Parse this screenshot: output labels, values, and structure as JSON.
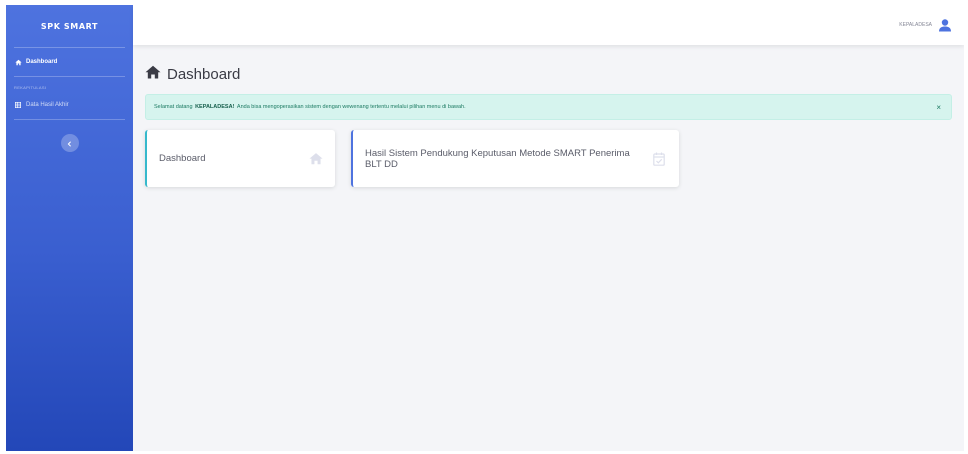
{
  "brand": "SPK SMART",
  "sidebar": {
    "items": [
      {
        "label": "Dashboard",
        "icon": "home-icon"
      }
    ],
    "heading": "Rekapitulasi",
    "sub_items": [
      {
        "label": "Data Hasil Akhir",
        "icon": "table-icon"
      }
    ],
    "toggle_icon": "chevron-left-icon"
  },
  "topbar": {
    "user_name": "KEPALADESA",
    "user_icon": "user-icon"
  },
  "main": {
    "title": "Dashboard",
    "title_icon": "home-icon",
    "alert": {
      "prefix": "Selamat datang",
      "user": "KEPALADESA!",
      "suffix": "Anda bisa mengoperasikan sistem dengan wewenang tertentu melalui pilihan menu di bawah.",
      "close": "×"
    },
    "cards": [
      {
        "label": "Dashboard",
        "icon": "home-icon"
      },
      {
        "label": "Hasil Sistem Pendukung Keputusan Metode SMART Penerima BLT DD",
        "icon": "calendar-check-icon"
      }
    ]
  },
  "colors": {
    "sidebar_top": "#4e73df",
    "sidebar_bottom": "#2347b8",
    "alert_bg": "#d6f4ee",
    "card_teal": "#36b9cc",
    "card_blue": "#4e73df"
  }
}
